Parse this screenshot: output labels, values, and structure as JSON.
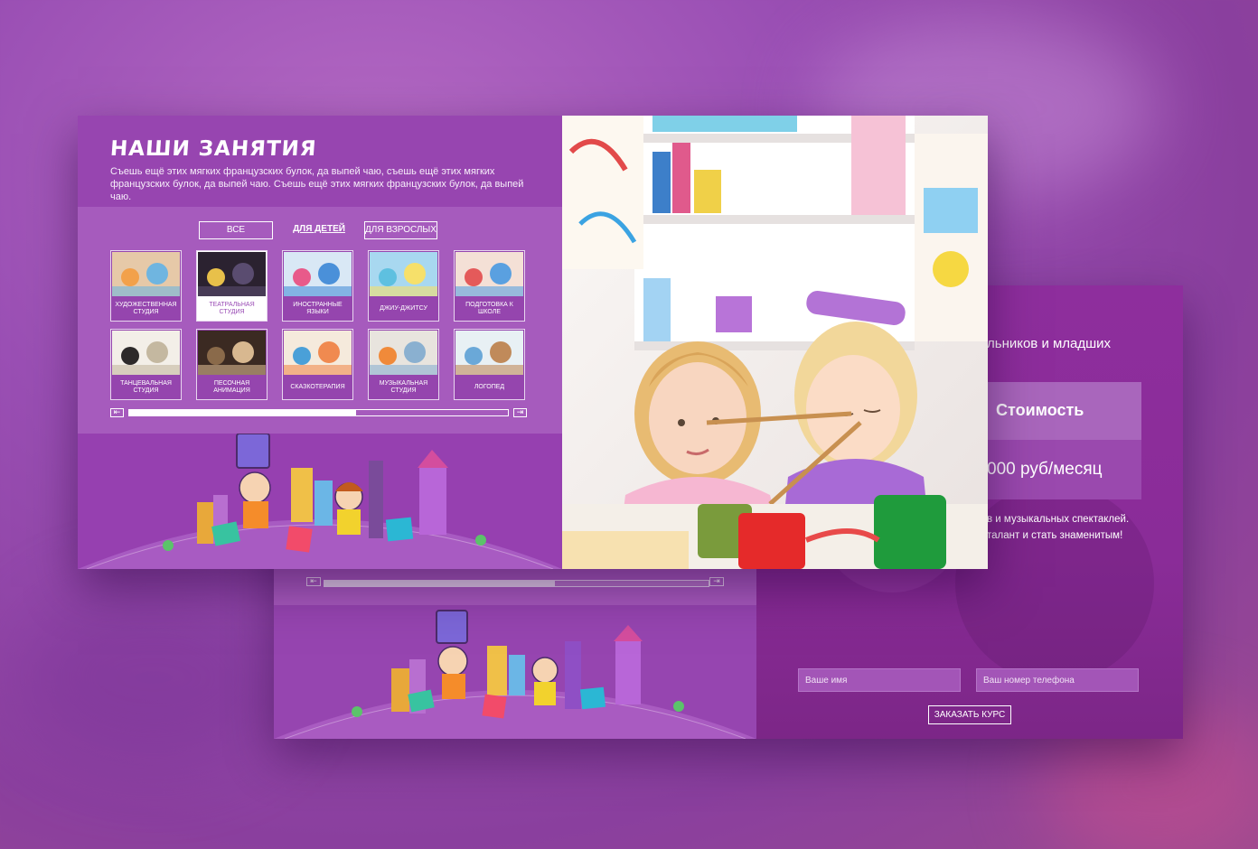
{
  "section": {
    "title": "НАШИ ЗАНЯТИЯ",
    "description": "Съешь ещё этих мягких французских булок, да выпей чаю, съешь ещё этих мягких французских булок, да выпей чаю. Съешь ещё этих мягких французских булок, да выпей чаю."
  },
  "tabs": [
    "ВСЕ",
    "ДЛЯ ДЕТЕЙ",
    "ДЛЯ ВЗРОСЛЫХ"
  ],
  "active_tab": "ДЛЯ ДЕТЕЙ",
  "activities": [
    {
      "label": "ХУДОЖЕСТВЕННАЯ СТУДИЯ"
    },
    {
      "label": "ТЕАТРАЛЬНАЯ СТУДИЯ"
    },
    {
      "label": "ИНОСТРАННЫЕ ЯЗЫКИ"
    },
    {
      "label": "ДЖИУ-ДЖИТСУ"
    },
    {
      "label": "ПОДГОТОВКА К ШКОЛЕ"
    },
    {
      "label": "ТАНЦЕВАЛЬНАЯ СТУДИЯ"
    },
    {
      "label": "ПЕСОЧНАЯ АНИМАЦИЯ"
    },
    {
      "label": "СКАЗКОТЕРАПИЯ"
    },
    {
      "label": "МУЗЫКАЛЬНАЯ СТУДИЯ"
    },
    {
      "label": "ЛОГОПЕД"
    }
  ],
  "scroll": {
    "prev": "⇤",
    "next": "⇥",
    "front_progress": 0.6,
    "back_progress": 0.6
  },
  "detail": {
    "subtitle": "льников и младших",
    "cost_label": "Стоимость",
    "price": "000 руб/месяц",
    "desc_line1": "в и музыкальных спектаклей.",
    "desc_line2": "талант и стать знаменитым!",
    "name_placeholder": "Ваше имя",
    "phone_placeholder": "Ваш номер телефона",
    "order_button": "ЗАКАЗАТЬ КУРС"
  },
  "colors": {
    "brand": "#9a4cb5",
    "accent_dark": "#8a2c98",
    "text": "#ffffff"
  }
}
